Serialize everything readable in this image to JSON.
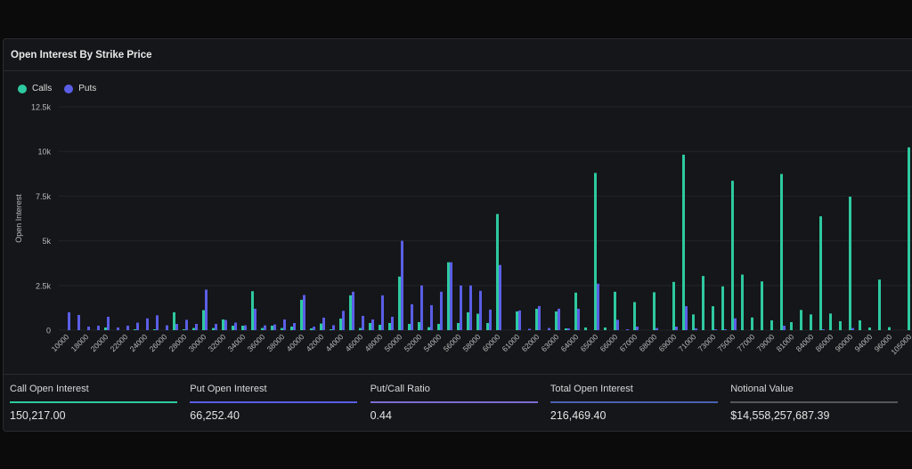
{
  "panel": {
    "title": "Open Interest By Strike Price"
  },
  "colors": {
    "calls": "#2ec9a0",
    "puts": "#5a5ee6",
    "grid": "#232428",
    "axis_text": "#b8b8b8"
  },
  "chart_data": {
    "type": "bar",
    "title": "Open Interest By Strike Price",
    "ylabel": "Open Interest",
    "xlabel": "",
    "ylim": [
      0,
      12500
    ],
    "yticks": [
      0,
      2500,
      5000,
      7500,
      10000,
      12500
    ],
    "ytick_labels": [
      "0",
      "2.5k",
      "5k",
      "7.5k",
      "10k",
      "12.5k"
    ],
    "grid": true,
    "legend_placement": "top-left",
    "categories": [
      "10000",
      "",
      "18000",
      "",
      "20000",
      "",
      "22000",
      "",
      "24000",
      "",
      "26000",
      "",
      "28000",
      "",
      "30000",
      "",
      "32000",
      "",
      "34000",
      "",
      "36000",
      "",
      "38000",
      "",
      "40000",
      "",
      "42000",
      "",
      "44000",
      "",
      "46000",
      "",
      "48000",
      "",
      "50000",
      "",
      "52000",
      "",
      "54000",
      "",
      "56000",
      "",
      "58000",
      "",
      "60000",
      "",
      "61000",
      "",
      "62000",
      "",
      "63000",
      "",
      "64000",
      "",
      "65000",
      "",
      "66000",
      "",
      "67000",
      "",
      "68000",
      "",
      "69000",
      "",
      "71000",
      "",
      "73000",
      "",
      "75000",
      "",
      "77000",
      "",
      "79000",
      "",
      "81000",
      "",
      "84000",
      "",
      "86000",
      "",
      "90000",
      "",
      "94000",
      "",
      "96000",
      "",
      "105000"
    ],
    "series": [
      {
        "name": "Calls",
        "values": [
          0,
          0,
          0,
          0,
          150,
          0,
          0,
          50,
          0,
          50,
          0,
          1000,
          50,
          120,
          1120,
          120,
          600,
          250,
          250,
          2180,
          120,
          250,
          120,
          200,
          1700,
          100,
          370,
          50,
          650,
          1950,
          120,
          400,
          300,
          400,
          3000,
          350,
          450,
          170,
          350,
          3800,
          400,
          1000,
          920,
          400,
          6500,
          0,
          1050,
          0,
          1200,
          0,
          1050,
          100,
          2100,
          150,
          8800,
          150,
          2150,
          0,
          1570,
          0,
          2120,
          0,
          2700,
          9820,
          880,
          3030,
          1340,
          2450,
          8360,
          3110,
          710,
          2730,
          550,
          8740,
          450,
          1130,
          880,
          6370,
          930,
          500,
          7470,
          550,
          150,
          2830,
          170,
          0,
          10230
        ]
      },
      {
        "name": "Puts",
        "values": [
          1000,
          850,
          200,
          250,
          750,
          150,
          250,
          420,
          660,
          830,
          270,
          350,
          580,
          350,
          2270,
          350,
          570,
          420,
          270,
          1200,
          270,
          320,
          600,
          400,
          1970,
          200,
          700,
          280,
          1080,
          2150,
          800,
          600,
          1950,
          750,
          5000,
          1450,
          2500,
          1400,
          2150,
          3800,
          2500,
          2500,
          2200,
          1150,
          3650,
          0,
          1100,
          80,
          1350,
          120,
          1200,
          100,
          1200,
          0,
          2600,
          0,
          580,
          50,
          200,
          0,
          120,
          0,
          200,
          1340,
          100,
          0,
          50,
          50,
          660,
          0,
          0,
          0,
          0,
          250,
          0,
          0,
          0,
          50,
          0,
          0,
          120,
          0,
          0,
          0,
          0,
          0,
          0
        ]
      }
    ]
  },
  "stats": [
    {
      "label": "Call Open Interest",
      "value": "150,217.00",
      "color": "#2ec9a0"
    },
    {
      "label": "Put Open Interest",
      "value": "66,252.40",
      "color": "#5a5ee6"
    },
    {
      "label": "Put/Call Ratio",
      "value": "0.44",
      "color": "#7c6cd4"
    },
    {
      "label": "Total Open Interest",
      "value": "216,469.40",
      "color": "#4a62b0"
    },
    {
      "label": "Notional Value",
      "value": "$14,558,257,687.39",
      "color": "#555659"
    }
  ]
}
